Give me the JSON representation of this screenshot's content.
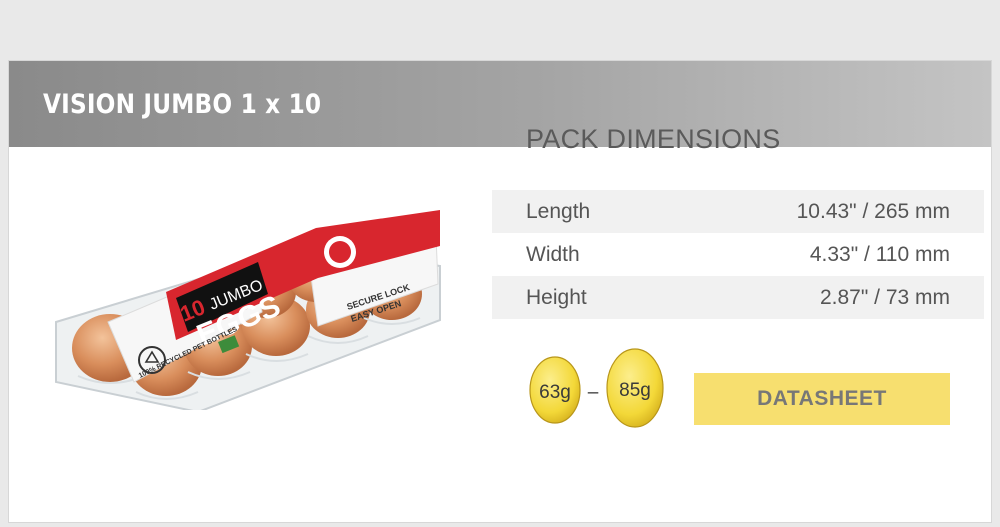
{
  "product": {
    "title": "VISION JUMBO 1 x 10"
  },
  "carton": {
    "count": "10",
    "size": "JUMBO",
    "name": "EGGS",
    "seal_line1": "SECURE LOCK",
    "seal_line2": "EASY OPEN",
    "recycled_text": "100% RECYCLED PET BOTTLES"
  },
  "dimensions": {
    "title": "PACK DIMENSIONS",
    "rows": [
      {
        "label": "Length",
        "value": "10.43\" / 265 mm"
      },
      {
        "label": "Width",
        "value": "4.33\" / 110 mm"
      },
      {
        "label": "Height",
        "value": "2.87\" / 73 mm"
      }
    ]
  },
  "weights": {
    "min": "63g",
    "separator": "–",
    "max": "85g"
  },
  "datasheet_button": {
    "label": "DATASHEET"
  },
  "colors": {
    "header_gradient_start": "#8a8a8a",
    "header_gradient_end": "#c4c4c4",
    "button": "#f7df6f",
    "egg": "#f6df4a",
    "carton_red": "#d8262e"
  }
}
